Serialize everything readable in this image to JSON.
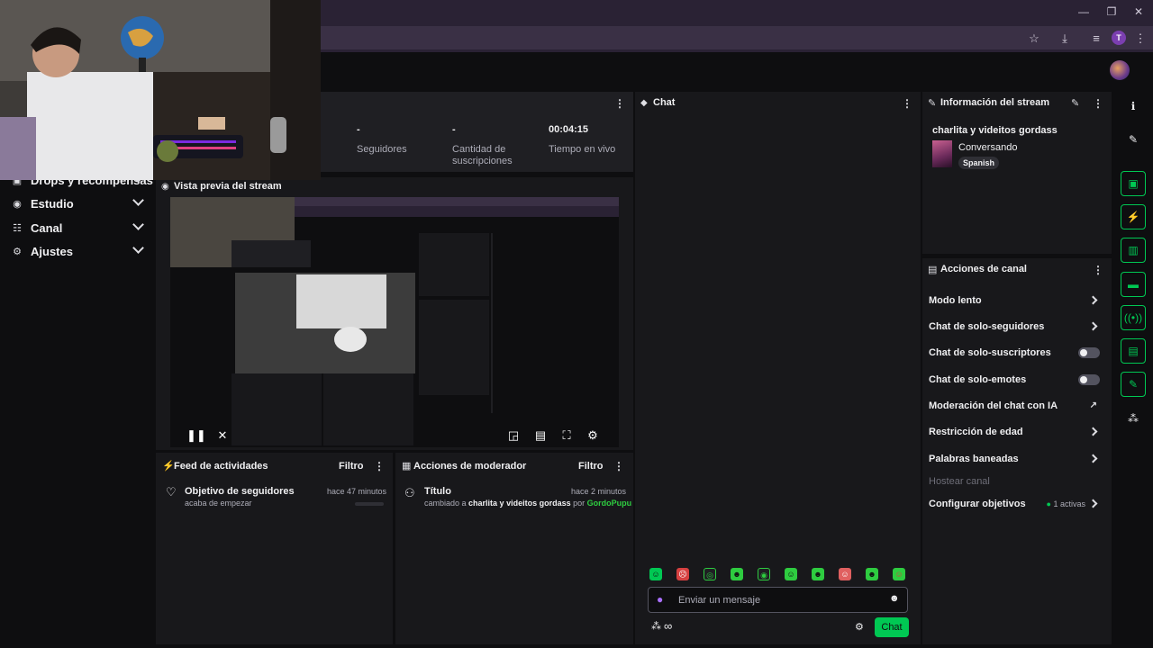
{
  "window_controls": {
    "minimize": "—",
    "restore": "❐",
    "close": "✕"
  },
  "browser": {
    "profile_initial": "T"
  },
  "sidebar": {
    "items": [
      {
        "label": "Drops y recompensas"
      },
      {
        "label": "Estudio"
      },
      {
        "label": "Canal"
      },
      {
        "label": "Ajustes"
      }
    ]
  },
  "stats": {
    "followers_value": "-",
    "followers_label": "Seguidores",
    "subs_value": "-",
    "subs_label": "Cantidad de suscripciones",
    "live_value": "00:04:15",
    "live_label": "Tiempo en vivo"
  },
  "preview": {
    "title": "Vista previa del stream"
  },
  "activity": {
    "title": "Feed de actividades",
    "filter": "Filtro",
    "item": {
      "title": "Objetivo de seguidores",
      "sub": "acaba de empezar",
      "time": "hace 47 minutos"
    }
  },
  "modactions": {
    "title": "Acciones de moderador",
    "filter": "Filtro",
    "item": {
      "title": "Título",
      "time": "hace 2 minutos",
      "changed": "cambiado a",
      "new_value": "charlita y videitos gordass",
      "by": "por",
      "user": "GordoPupu"
    }
  },
  "chat": {
    "title": "Chat",
    "placeholder": "Enviar un mensaje",
    "send": "Chat",
    "infinity": "∞"
  },
  "info": {
    "title": "Información del stream",
    "stream_title": "charlita y videitos gordass",
    "category": "Conversando",
    "tag": "Spanish"
  },
  "actions": {
    "title": "Acciones de canal",
    "items": [
      {
        "label": "Modo lento",
        "control": "chevron"
      },
      {
        "label": "Chat de solo-seguidores",
        "control": "chevron"
      },
      {
        "label": "Chat de solo-suscriptores",
        "control": "toggle"
      },
      {
        "label": "Chat de solo-emotes",
        "control": "toggle"
      },
      {
        "label": "Moderación del chat con IA",
        "control": "external"
      },
      {
        "label": "Restricción de edad",
        "control": "chevron"
      },
      {
        "label": "Palabras baneadas",
        "control": "chevron"
      },
      {
        "label": "Hostear canal",
        "control": "none"
      },
      {
        "label": "Configurar objetivos",
        "control": "chevron",
        "badge": "1 activas"
      }
    ]
  },
  "colors": {
    "accent": "#00c853",
    "panel": "#18181b",
    "bg": "#0e0e10",
    "browser": "#2a2234",
    "link_green": "#2ecc40"
  }
}
